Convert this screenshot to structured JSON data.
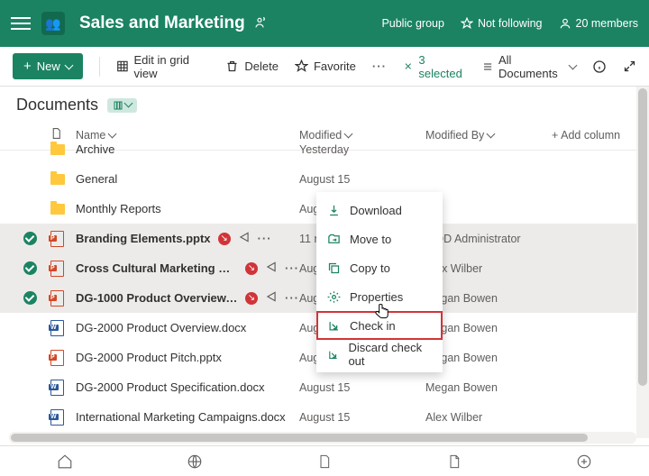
{
  "header": {
    "site_title": "Sales and Marketing",
    "group_type": "Public group",
    "follow_label": "Not following",
    "members_label": "20 members",
    "logo_emoji": "👥"
  },
  "toolbar": {
    "new_label": "New",
    "edit_grid_label": "Edit in grid view",
    "delete_label": "Delete",
    "favorite_label": "Favorite",
    "selected_label": "3 selected",
    "view_label": "All Documents"
  },
  "library": {
    "title": "Documents"
  },
  "columns": {
    "name": "Name",
    "modified": "Modified",
    "modified_by": "Modified By",
    "add_column": "Add column"
  },
  "rows": [
    {
      "type": "folder",
      "name": "Archive",
      "modified": "Yesterday",
      "by": "",
      "selected": false,
      "checked_out": false,
      "cut": true
    },
    {
      "type": "folder",
      "name": "General",
      "modified": "August 15",
      "by": "",
      "selected": false,
      "checked_out": false
    },
    {
      "type": "folder",
      "name": "Monthly Reports",
      "modified": "August 15",
      "by": "",
      "selected": false,
      "checked_out": false
    },
    {
      "type": "pptx",
      "name": "Branding Elements.pptx",
      "modified": "11 minutes ago",
      "by": "MOD Administrator",
      "selected": true,
      "checked_out": true
    },
    {
      "type": "pptx",
      "name": "Cross Cultural Marketing Ca...",
      "modified": "August 15",
      "by": "Alex Wilber",
      "selected": true,
      "checked_out": true
    },
    {
      "type": "pptx",
      "name": "DG-1000 Product Overview.p...",
      "modified": "August 15",
      "by": "Megan Bowen",
      "selected": true,
      "checked_out": true
    },
    {
      "type": "docx",
      "name": "DG-2000 Product Overview.docx",
      "modified": "August 15",
      "by": "Megan Bowen",
      "selected": false,
      "checked_out": false
    },
    {
      "type": "pptx",
      "name": "DG-2000 Product Pitch.pptx",
      "modified": "August 15",
      "by": "Megan Bowen",
      "selected": false,
      "checked_out": false
    },
    {
      "type": "docx",
      "name": "DG-2000 Product Specification.docx",
      "modified": "August 15",
      "by": "Megan Bowen",
      "selected": false,
      "checked_out": false
    },
    {
      "type": "docx",
      "name": "International Marketing Campaigns.docx",
      "modified": "August 15",
      "by": "Alex Wilber",
      "selected": false,
      "checked_out": false
    }
  ],
  "context_menu": {
    "download": "Download",
    "move_to": "Move to",
    "copy_to": "Copy to",
    "properties": "Properties",
    "check_in": "Check in",
    "discard_check_out": "Discard check out"
  },
  "cursor_glyph": "🖱️",
  "plus_glyph": "+"
}
